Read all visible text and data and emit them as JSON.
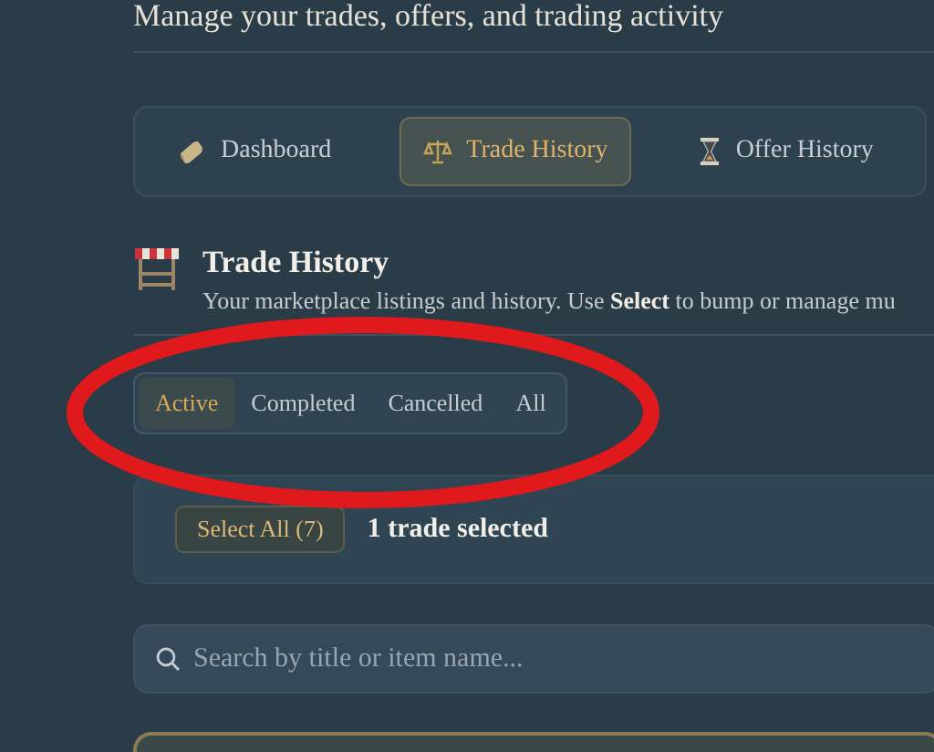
{
  "page_subtitle": "Manage your trades, offers, and trading activity",
  "nav_tabs": [
    {
      "label": "Dashboard",
      "kind": "bar",
      "selected": false
    },
    {
      "label": "Trade History",
      "kind": "scales",
      "selected": true
    },
    {
      "label": "Offer History",
      "kind": "hourglass",
      "selected": false
    }
  ],
  "section": {
    "title": "Trade History",
    "description": "Your marketplace listings and history. Use **Select** to bump or manage mu"
  },
  "filter_tabs": [
    {
      "label": "Active",
      "selected": true
    },
    {
      "label": "Completed",
      "selected": false
    },
    {
      "label": "Cancelled",
      "selected": false
    },
    {
      "label": "All",
      "selected": false
    }
  ],
  "selection_bar": {
    "button": "Select All (7)",
    "status": "1 trade selected"
  },
  "search": {
    "placeholder": "Search by title or item name..."
  },
  "annotation": {
    "kind": "ellipse",
    "color": "#e0191c"
  }
}
